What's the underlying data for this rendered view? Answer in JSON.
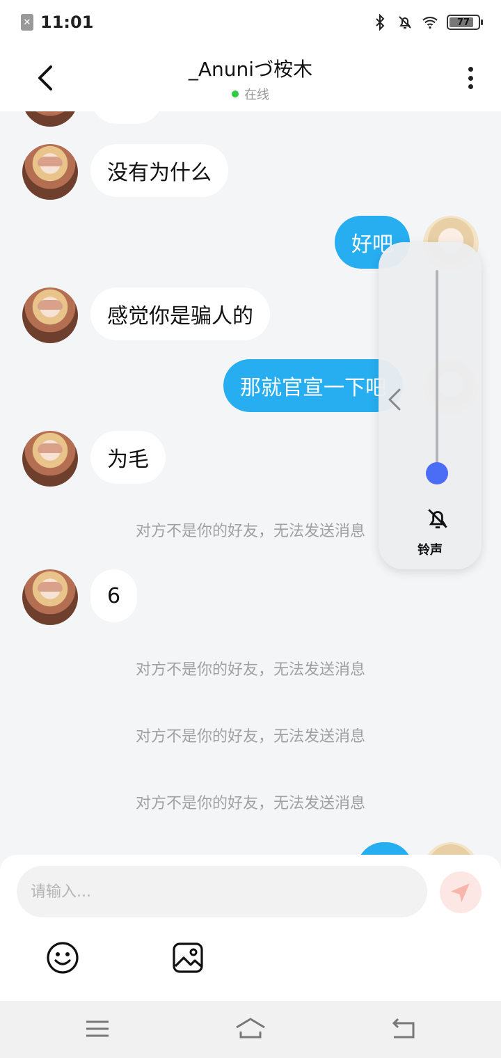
{
  "status_bar": {
    "time": "11:01",
    "battery": "77"
  },
  "header": {
    "title": "_Anuniづ桉木",
    "status": "在线"
  },
  "messages": {
    "m1": "没有为什么",
    "m2": "好吧",
    "m3": "感觉你是骗人的",
    "m4": "那就官宣一下吧",
    "m5": "为毛",
    "m6": "6",
    "system": "对方不是你的好友，无法发送消息"
  },
  "volume_panel": {
    "label": "铃声",
    "level": 0.0
  },
  "input": {
    "placeholder": "请输入..."
  },
  "colors": {
    "outgoing_bubble": "#27aef0",
    "volume_knob": "#4b6cf5",
    "online_dot": "#2ecc40"
  }
}
